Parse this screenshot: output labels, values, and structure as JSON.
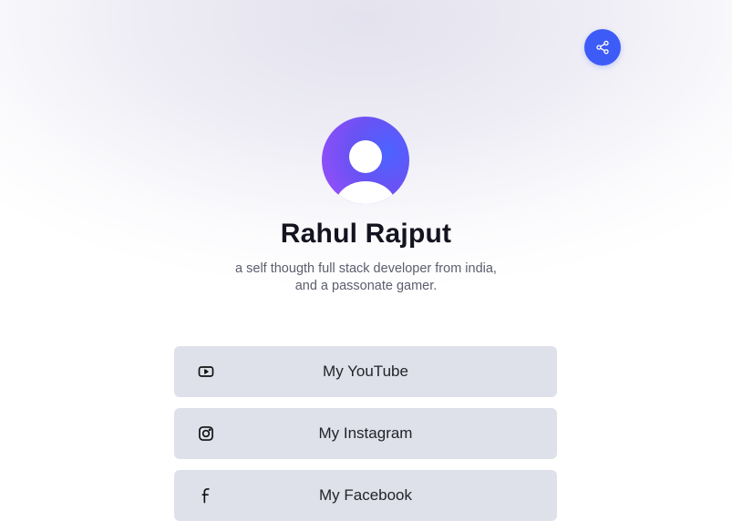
{
  "share": {
    "icon": "share-icon",
    "color": "#3d5bf6"
  },
  "profile": {
    "avatar_icon": "user-avatar-icon",
    "name": "Rahul Rajput",
    "bio_line1": "a self thougth full stack developer from india,",
    "bio_line2": "and a passonate gamer."
  },
  "links": [
    {
      "label": "My YouTube",
      "icon": "youtube-icon"
    },
    {
      "label": "My Instagram",
      "icon": "instagram-icon"
    },
    {
      "label": "My Facebook",
      "icon": "facebook-icon"
    }
  ]
}
